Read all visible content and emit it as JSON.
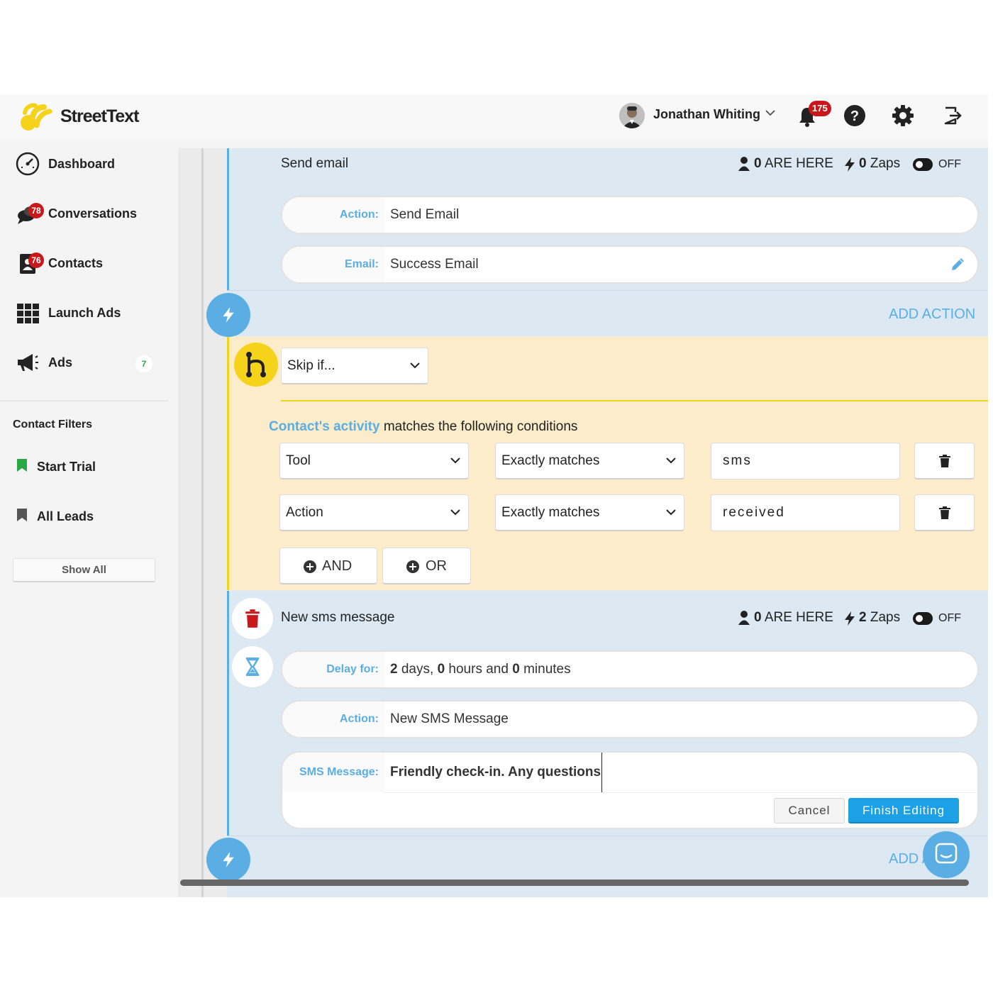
{
  "header": {
    "brand": "StreetText",
    "user_name": "Jonathan Whiting",
    "notifications_count": "175"
  },
  "sidebar": {
    "items": [
      {
        "label": "Dashboard"
      },
      {
        "label": "Conversations",
        "badge": "78"
      },
      {
        "label": "Contacts",
        "badge": "76"
      },
      {
        "label": "Launch Ads"
      },
      {
        "label": "Ads",
        "count": "7"
      }
    ],
    "filters_title": "Contact Filters",
    "filters": [
      {
        "label": "Start Trial",
        "color": "#2aa845"
      },
      {
        "label": "All Leads",
        "color": "#555555"
      }
    ],
    "show_all": "Show All"
  },
  "workflow": {
    "step1": {
      "title": "Send email",
      "here_count": "0",
      "here_label": "ARE HERE",
      "zaps_count": "0",
      "zaps_label": "Zaps",
      "toggle_label": "OFF",
      "action_label": "Action:",
      "action_value": "Send Email",
      "email_label": "Email:",
      "email_value": "Success Email"
    },
    "add_action_label": "ADD ACTION",
    "condition": {
      "skip_select": "Skip if...",
      "intro_highlight": "Contact's activity",
      "intro_rest": " matches the following conditions",
      "rows": [
        {
          "field": "Tool",
          "operator": "Exactly matches",
          "value": "sms"
        },
        {
          "field": "Action",
          "operator": "Exactly matches",
          "value": "received"
        }
      ],
      "and_label": "AND",
      "or_label": "OR"
    },
    "step2": {
      "title": "New sms message",
      "here_count": "0",
      "here_label": "ARE HERE",
      "zaps_count": "2",
      "zaps_label": "Zaps",
      "toggle_label": "OFF",
      "delay_label": "Delay for:",
      "delay_days": "2",
      "delay_days_unit": " days, ",
      "delay_hours": "0",
      "delay_hours_unit": " hours and ",
      "delay_minutes": "0",
      "delay_minutes_unit": " minutes",
      "action_label": "Action:",
      "action_value": "New SMS Message",
      "sms_label": "SMS Message:",
      "sms_value": "Friendly check-in. Any questions",
      "cancel_label": "Cancel",
      "finish_label": "Finish Editing",
      "add_label_partial": "ADD A"
    }
  },
  "colors": {
    "accent_blue": "#5aaee3",
    "primary_button": "#1da1e6",
    "badge_red": "#c8181c",
    "brand_yellow": "#f5d31a",
    "panel_blue": "#dce9f3",
    "panel_yellow": "#fcecca"
  }
}
